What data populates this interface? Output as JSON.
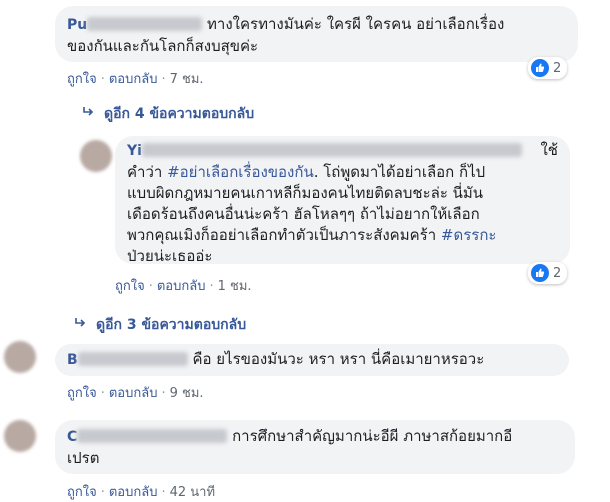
{
  "comments": [
    {
      "name": "Pu",
      "text_line1": "ทางใครทางมันค่ะ ใครผี ใครคน อย่าเลือกเรื่อง",
      "text_line2": "ของกันและกันโลกก็สงบสุขค่ะ",
      "like_label": "ถูกใจ",
      "reply_label": "ตอบกลับ",
      "time": "7 ชม.",
      "reactions": "2"
    },
    {
      "name": "Yi",
      "name_tail": "ใช้",
      "text_line1_a": "คำว่า ",
      "hashtag1": "#อย่าเลือกเรื่องของกัน",
      "text_line1_b": ". โถ่พูดมาได้อย่าเลือก ก็ไป",
      "text_line2": "แบบผิดกฎหมายคนเกาหลีก็มองคนไทยติดลบชะล่ะ นี่มัน",
      "text_line3": "เดือดร้อนถึงคนอื่นน่ะคร้า ฮัลโหลๆๆ ถ้าไม่อยากให้เลือก",
      "text_line4_a": "พวกคุณเมิงก็ออย่าเลือกทำตัวเป็นภาระสังคมคร้า ",
      "hashtag2": "#ดรรกะ",
      "text_line5": "ป่วยน่ะเธออ่ะ",
      "like_label": "ถูกใจ",
      "reply_label": "ตอบกลับ",
      "time": "1 ชม.",
      "reactions": "2"
    },
    {
      "name": "B",
      "text": "คือ  ยไรของมันวะ หรา หรา นี่คือเมายาหรอวะ",
      "like_label": "ถูกใจ",
      "reply_label": "ตอบกลับ",
      "time": "9 ชม."
    },
    {
      "name": "C",
      "text_line1": "การศึกษาสำคัญมากน่ะอีผี ภาษาสก้อยมากอี",
      "text_line2": "เปรต",
      "like_label": "ถูกใจ",
      "reply_label": "ตอบกลับ",
      "time": "42 นาที"
    }
  ],
  "more_replies_1": "ดูอีก 4 ข้อความตอบกลับ",
  "more_replies_2": "ดูอีก 3 ข้อความตอบกลับ",
  "colors": {
    "link": "#385898",
    "bubble": "#f2f3f5",
    "like": "#1877f2"
  }
}
